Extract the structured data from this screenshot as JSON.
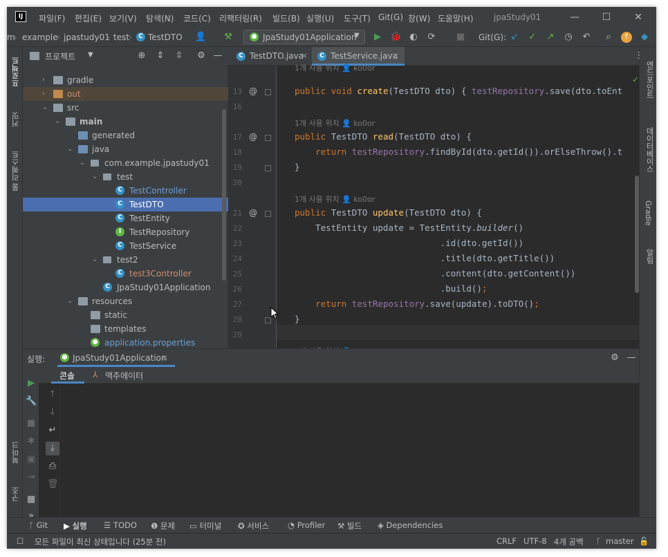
{
  "title_bar": {
    "logo": "IJ",
    "menu": [
      "파일(F)",
      "편집(E)",
      "보기(V)",
      "탐색(N)",
      "코드(C)",
      "리팩터링(R)",
      "빌드(B)",
      "실행(U)",
      "도구(T)",
      "Git(G)",
      "창(W)",
      "도움말(H)"
    ],
    "project_name": "jpaStudy01",
    "controls": [
      "—",
      "☐",
      "✕"
    ]
  },
  "breadcrumb": [
    "m",
    "example",
    "jpastudy01",
    "test",
    "TestDTO"
  ],
  "nav_toolbar": {
    "run_config": "JpaStudy01Application",
    "git_label": "Git(G):"
  },
  "left_stripe": {
    "top": [
      "프로젝트",
      "커밋",
      "풀 리퀘스트"
    ],
    "bottom": [
      "북마크",
      "구조"
    ]
  },
  "right_stripe": [
    "엔드포인트",
    "데이터베이스",
    "Gradle",
    "알림"
  ],
  "project_panel": {
    "title": "프로젝트",
    "tree": [
      {
        "depth": 1,
        "arrow": "›",
        "icon": "folder",
        "label": "gradle",
        "style": ""
      },
      {
        "depth": 1,
        "arrow": "›",
        "icon": "folder-excluded",
        "label": "out",
        "style": "out"
      },
      {
        "depth": 1,
        "arrow": "⌄",
        "icon": "folder",
        "label": "src",
        "style": ""
      },
      {
        "depth": 2,
        "arrow": "⌄",
        "icon": "folder-module",
        "label": "main",
        "style": "bold"
      },
      {
        "depth": 3,
        "arrow": "",
        "icon": "folder-generated",
        "label": "generated",
        "style": ""
      },
      {
        "depth": 3,
        "arrow": "⌄",
        "icon": "folder-src",
        "label": "java",
        "style": ""
      },
      {
        "depth": 4,
        "arrow": "⌄",
        "icon": "package",
        "label": "com.example.jpastudy01",
        "style": ""
      },
      {
        "depth": 5,
        "arrow": "⌄",
        "icon": "package",
        "label": "test",
        "style": ""
      },
      {
        "depth": 6,
        "arrow": "",
        "icon": "class",
        "label": "TestController",
        "style": "blue"
      },
      {
        "depth": 6,
        "arrow": "",
        "icon": "class",
        "label": "TestDTO",
        "style": "selected"
      },
      {
        "depth": 6,
        "arrow": "",
        "icon": "class",
        "label": "TestEntity",
        "style": ""
      },
      {
        "depth": 6,
        "arrow": "",
        "icon": "interface",
        "label": "TestRepository",
        "style": ""
      },
      {
        "depth": 6,
        "arrow": "",
        "icon": "class",
        "label": "TestService",
        "style": ""
      },
      {
        "depth": 5,
        "arrow": "⌄",
        "icon": "package",
        "label": "test2",
        "style": ""
      },
      {
        "depth": 6,
        "arrow": "",
        "icon": "class",
        "label": "test3Controller",
        "style": "orange"
      },
      {
        "depth": 5,
        "arrow": "",
        "icon": "spring-class",
        "label": "JpaStudy01Application",
        "style": ""
      },
      {
        "depth": 3,
        "arrow": "⌄",
        "icon": "folder-res",
        "label": "resources",
        "style": ""
      },
      {
        "depth": 4,
        "arrow": "",
        "icon": "folder",
        "label": "static",
        "style": ""
      },
      {
        "depth": 4,
        "arrow": "",
        "icon": "folder",
        "label": "templates",
        "style": ""
      },
      {
        "depth": 4,
        "arrow": "",
        "icon": "properties",
        "label": "application.properties",
        "style": "blue"
      }
    ]
  },
  "editor": {
    "tabs": [
      {
        "label": "TestDTO.java",
        "active": false
      },
      {
        "label": "TestService.java",
        "active": true
      }
    ],
    "usage_hint": "1개 사용 위치",
    "usage_author": "ko0or",
    "lines": [
      {
        "type": "hint",
        "partial": true
      },
      {
        "type": "code",
        "num": "13",
        "at": true,
        "fold": true,
        "html": "<span class=\"kw\">public void </span><span class=\"fn\">create</span>(TestDTO dto) { <span class=\"fld\">testRepository</span>.save(dto.toEnt"
      },
      {
        "type": "code",
        "num": "16",
        "html": ""
      },
      {
        "type": "hint"
      },
      {
        "type": "code",
        "num": "17",
        "at": true,
        "fold": true,
        "html": "<span class=\"kw\">public </span>TestDTO <span class=\"fn\">read</span>(TestDTO dto) {"
      },
      {
        "type": "code",
        "num": "18",
        "html": "    <span class=\"kw\">return </span><span class=\"fld\">testRepository</span>.findById(dto.getId()).orElseThrow().t"
      },
      {
        "type": "code",
        "num": "19",
        "fold": true,
        "html": "}"
      },
      {
        "type": "code",
        "num": "20",
        "html": ""
      },
      {
        "type": "hint"
      },
      {
        "type": "code",
        "num": "21",
        "at": true,
        "fold": true,
        "html": "<span class=\"kw\">public </span>TestDTO <span class=\"fn\">update</span>(TestDTO dto) {"
      },
      {
        "type": "code",
        "num": "22",
        "html": "    TestEntity update = TestEntity.<span class=\"ital\">builder</span>()"
      },
      {
        "type": "code",
        "num": "23",
        "html": "                            .id(dto.getId())"
      },
      {
        "type": "code",
        "num": "24",
        "html": "                            .title(dto.getTitle())"
      },
      {
        "type": "code",
        "num": "25",
        "html": "                            .content(dto.getContent())"
      },
      {
        "type": "code",
        "num": "26",
        "html": "                            .build()<span class=\"kw\">;</span>"
      },
      {
        "type": "code",
        "num": "27",
        "html": "    <span class=\"kw\">return </span><span class=\"fld\">testRepository</span>.save(update).toDTO()<span class=\"kw\">;</span>"
      },
      {
        "type": "code",
        "num": "28",
        "fold": true,
        "html": "}"
      },
      {
        "type": "code",
        "num": "29",
        "html": ""
      },
      {
        "type": "hint"
      }
    ]
  },
  "run_panel": {
    "label": "실행:",
    "tab": "JpaStudy01Application",
    "subtabs": [
      "콘솔",
      "액추에이터"
    ]
  },
  "bottom_bar": [
    "Git",
    "실행",
    "TODO",
    "문제",
    "터미널",
    "서비스",
    "Profiler",
    "빌드",
    "Dependencies"
  ],
  "status_bar": {
    "message": "모든 파일이 최신 상태입니다 (25분 전)",
    "line_sep": "CRLF",
    "encoding": "UTF-8",
    "indent": "4개 공백",
    "branch": "master"
  },
  "colors": {
    "accent": "#4a88c7",
    "selection": "#4b6eaf",
    "keyword": "#cc7832",
    "method": "#ffc66d",
    "field": "#9876aa"
  }
}
